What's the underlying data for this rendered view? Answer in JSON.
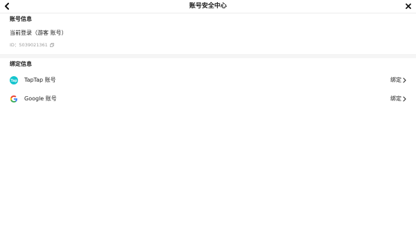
{
  "header": {
    "title": "账号安全中心",
    "back_icon": "chevron-left-icon",
    "close_icon": "close-icon"
  },
  "account_info": {
    "section_title": "账号信息",
    "login_status": "当前登录（游客 账号）",
    "id_label": "ID：5039021361",
    "copy_icon": "copy-icon"
  },
  "bindings": {
    "section_title": "绑定信息",
    "items": [
      {
        "icon": "taptap-icon",
        "label": "TapTap 账号",
        "action": "绑定"
      },
      {
        "icon": "google-icon",
        "label": "Google 账号",
        "action": "绑定"
      }
    ]
  },
  "colors": {
    "background": "#ffffff",
    "divider_band": "#f5f5f5",
    "taptap_brand": "#15c5ce",
    "secondary_text": "#9a9a9a"
  }
}
